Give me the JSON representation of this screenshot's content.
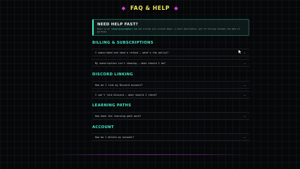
{
  "header": {
    "title": "FAQ & HELP",
    "left_ornament": "◆",
    "right_ornament": "◆"
  },
  "help_box": {
    "heading": "NEED HELP FAST?",
    "body_prefix": "Email us at",
    "email": "rumegioplayer@gmail.com",
    "body_suffix": "and include your account email, a short description, and (if billing related) the date of purchase."
  },
  "sections": [
    {
      "heading": "BILLING & SUBSCRIPTIONS",
      "questions": [
        "I subscribed and need a refund — what's the policy?",
        "My subscription isn't showing — what should I do?"
      ]
    },
    {
      "heading": "DISCORD LINKING",
      "questions": [
        "How do I link my Discord account?",
        "I can't link Discord — what should I check?"
      ]
    },
    {
      "heading": "LEARNING PATHS",
      "questions": [
        "How does the learning path work?"
      ]
    },
    {
      "heading": "ACCOUNT",
      "questions": [
        "How do I delete my account?"
      ]
    }
  ],
  "chevron": "⌄",
  "colors": {
    "accent_teal": "#3fe3c5",
    "title_yellow": "#f0e85a",
    "ornament_magenta": "#d63ad6",
    "background": "#060708"
  }
}
